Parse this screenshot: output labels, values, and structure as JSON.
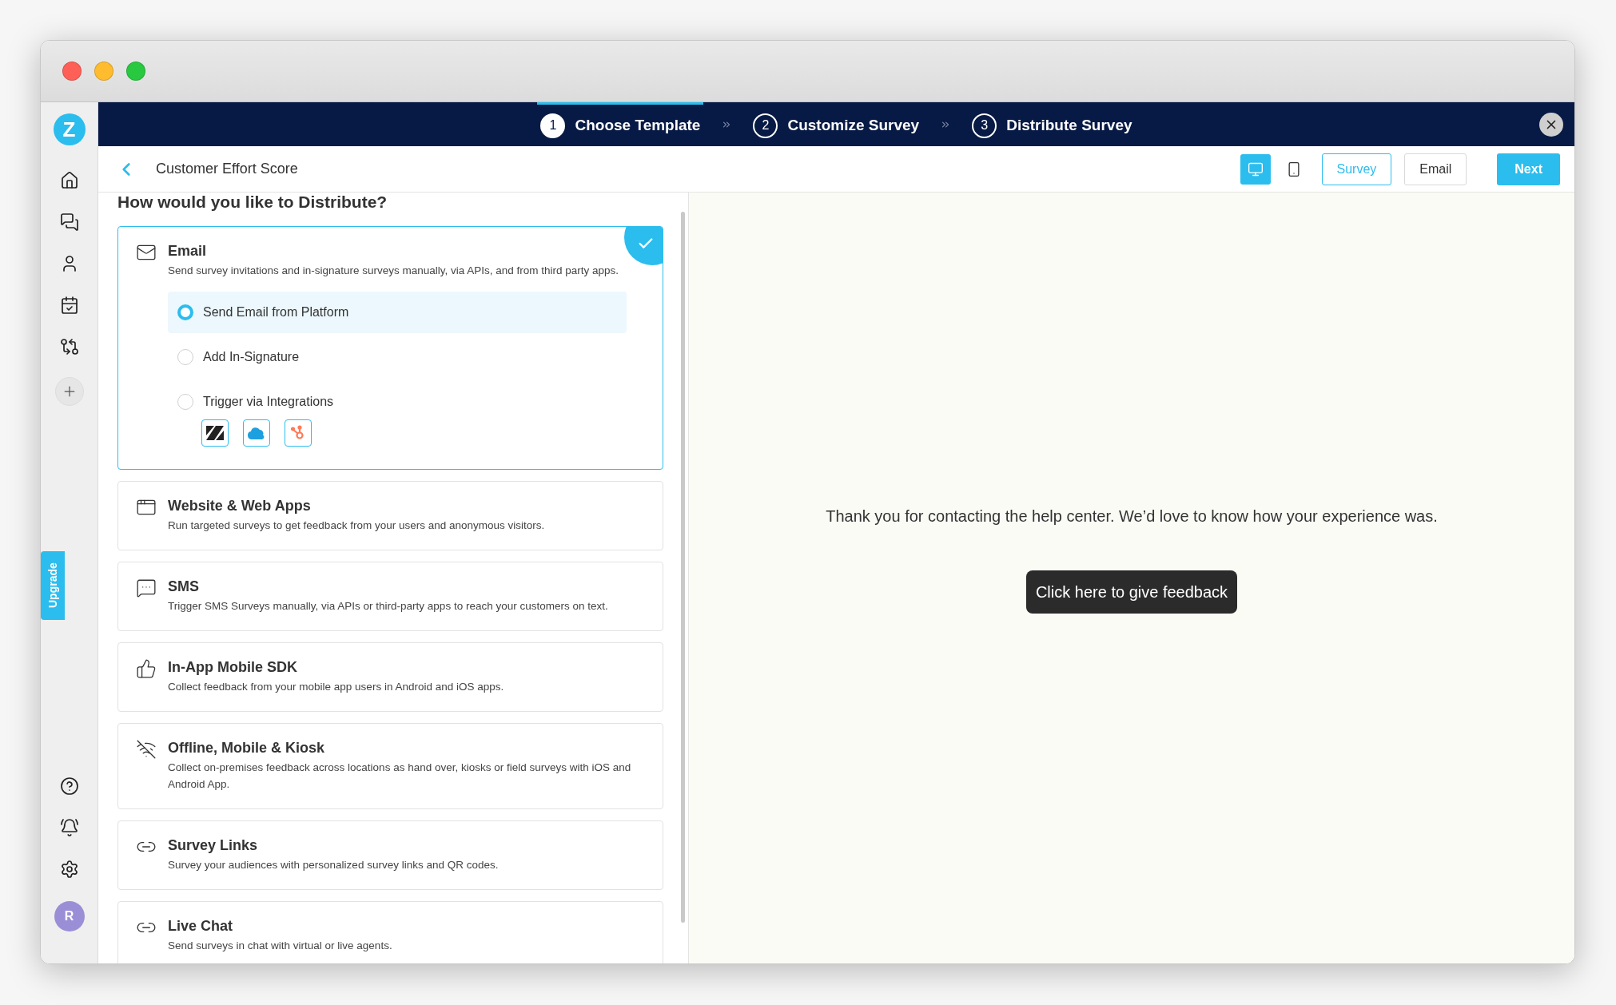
{
  "steps": [
    {
      "number": "1",
      "label": "Choose Template",
      "selected": true
    },
    {
      "number": "2",
      "label": "Customize Survey",
      "selected": false
    },
    {
      "number": "3",
      "label": "Distribute Survey",
      "selected": false
    }
  ],
  "sidebar": {
    "logo": "Z",
    "upgrade": "Upgrade",
    "avatar": "R"
  },
  "header": {
    "title": "Customer Effort Score",
    "devices": [
      {
        "selected": true
      },
      {
        "selected": false
      }
    ],
    "views": [
      {
        "label": "Survey",
        "selected": true
      },
      {
        "label": "Email",
        "selected": false
      }
    ],
    "next": "Next"
  },
  "distribute": {
    "heading": "How would you like to Distribute?",
    "cards": [
      {
        "title": "Email",
        "description": "Send survey invitations and in-signature surveys manually, via APIs, and from third party apps.",
        "selected": true,
        "options": [
          {
            "label": "Send Email from Platform",
            "selected": true
          },
          {
            "label": "Add In-Signature",
            "selected": false
          },
          {
            "label": "Trigger via Integrations",
            "selected": false
          }
        ]
      },
      {
        "title": "Website & Web Apps",
        "description": "Run targeted surveys to get feedback from your users and anonymous visitors.",
        "selected": false
      },
      {
        "title": "SMS",
        "description": "Trigger SMS Surveys manually, via APIs or third-party apps to reach your customers on text.",
        "selected": false
      },
      {
        "title": "In-App Mobile SDK",
        "description": "Collect feedback from your mobile app users in Android and iOS apps.",
        "selected": false
      },
      {
        "title": "Offline, Mobile & Kiosk",
        "description": "Collect on-premises feedback across locations as hand over, kiosks or field surveys with iOS and Android App.",
        "selected": false
      },
      {
        "title": "Survey Links",
        "description": "Survey your audiences with personalized survey links and QR codes.",
        "selected": false
      },
      {
        "title": "Live Chat",
        "description": "Send surveys in chat with virtual or live agents.",
        "selected": false
      }
    ]
  },
  "preview": {
    "message": "Thank you for contacting the help center. We’d love to know how your experience was.",
    "button": "Click here to give feedback"
  }
}
